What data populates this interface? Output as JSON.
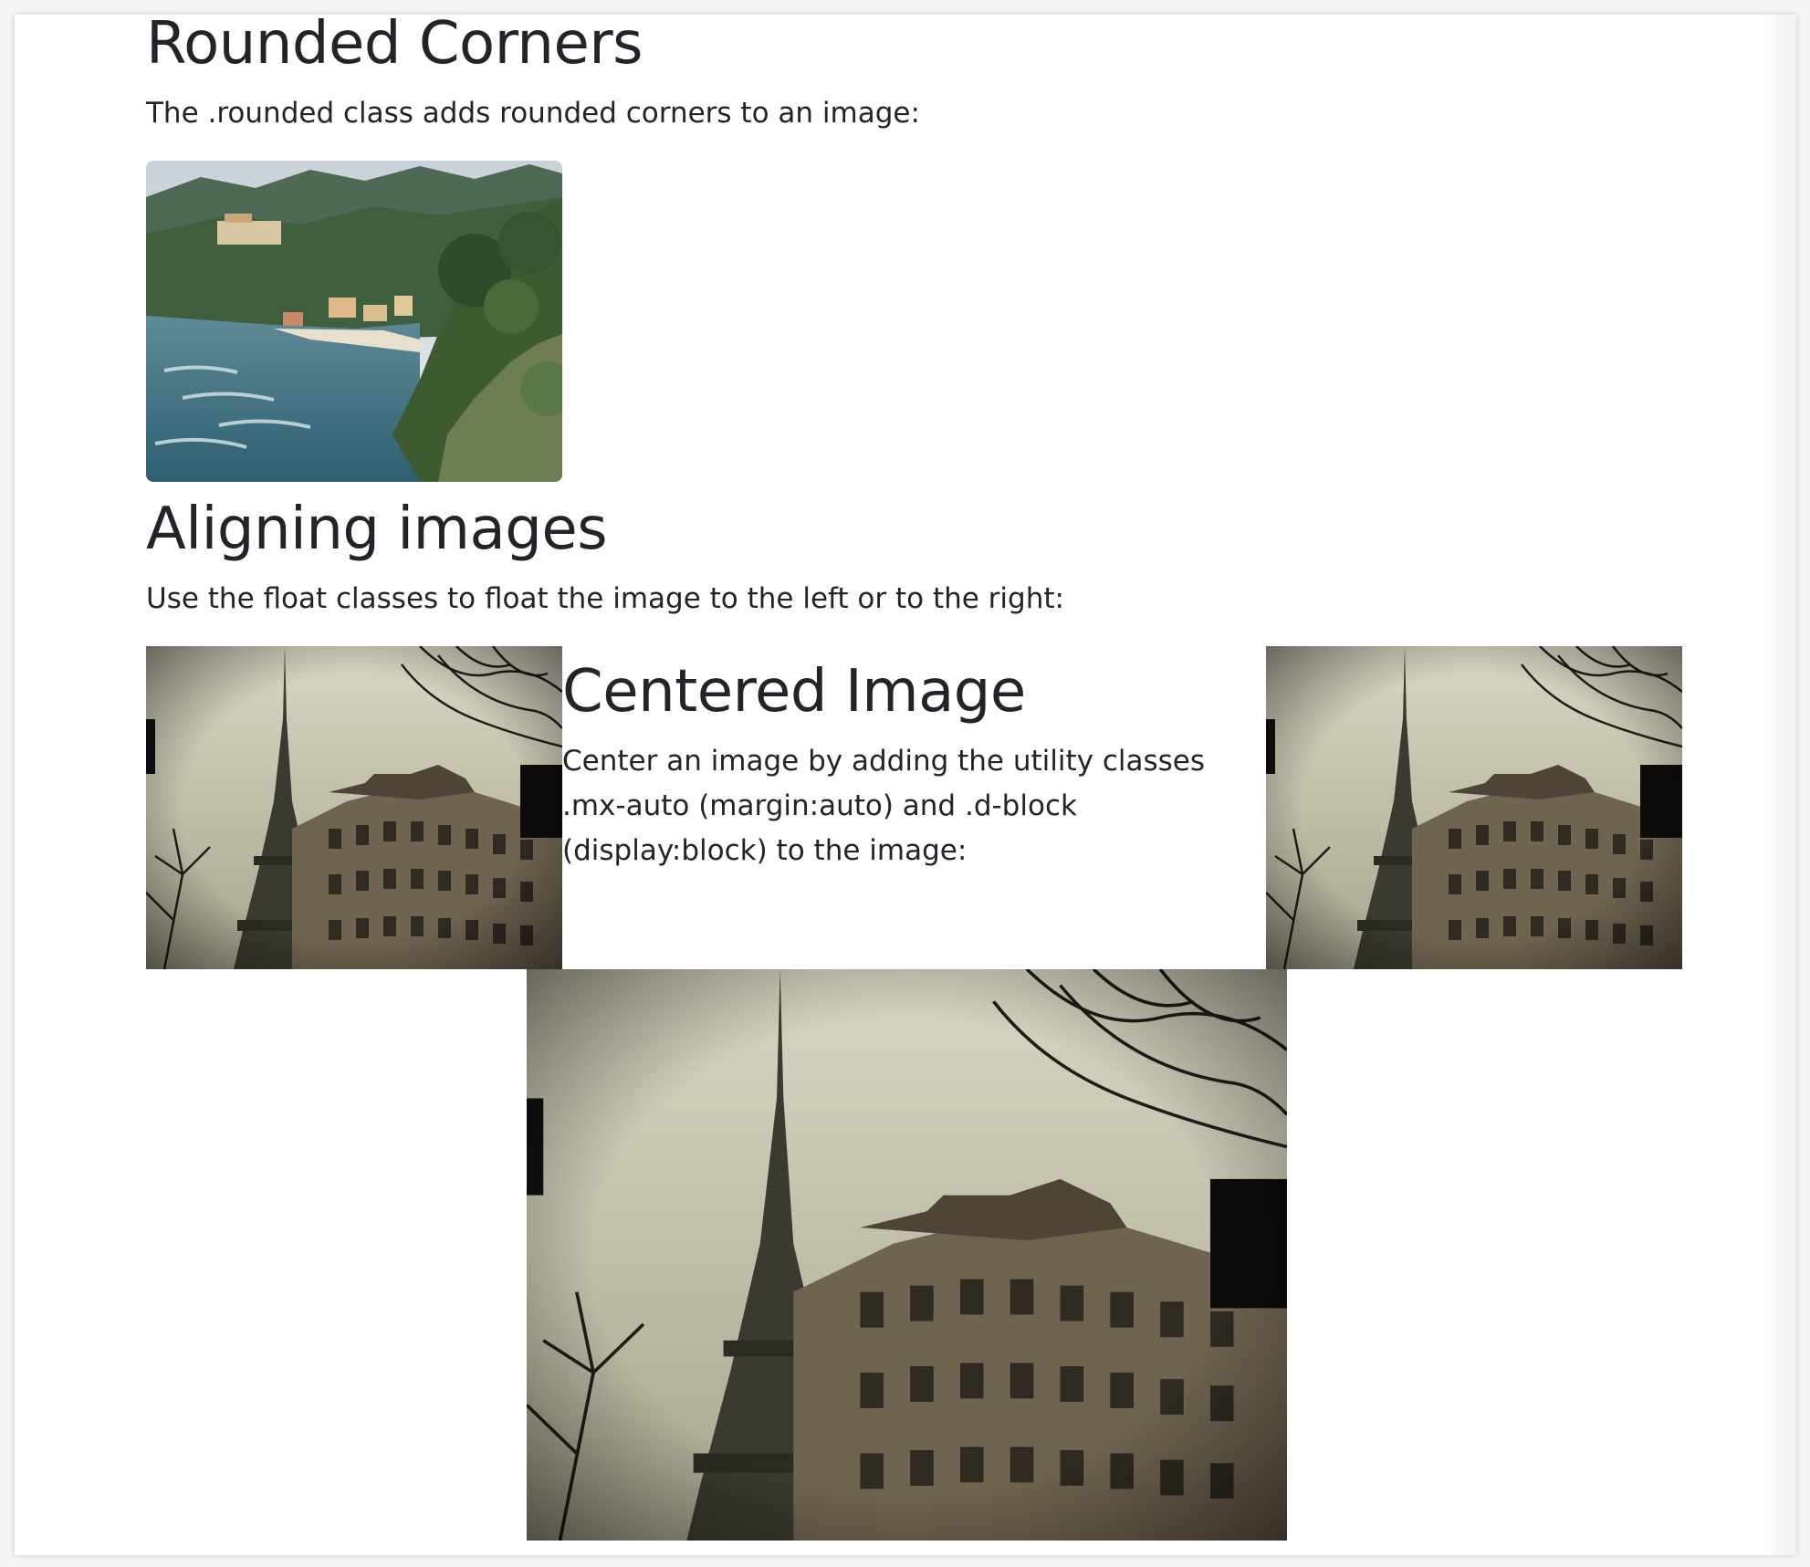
{
  "rounded": {
    "heading": "Rounded Corners",
    "text": "The .rounded class adds rounded corners to an image:",
    "image_icon": "coastal-village-photo"
  },
  "aligning": {
    "heading": "Aligning images",
    "text": "Use the float classes to float the image to the left or to the right:",
    "left_image_icon": "eiffel-tower-photo",
    "right_image_icon": "eiffel-tower-photo"
  },
  "centered": {
    "heading": "Centered Image",
    "text": "Center an image by adding the utility classes .mx-auto (margin:auto) and .d-block (display:block) to the image:",
    "image_icon": "eiffel-tower-photo"
  },
  "colors": {
    "text": "#212529",
    "background": "#ffffff"
  }
}
